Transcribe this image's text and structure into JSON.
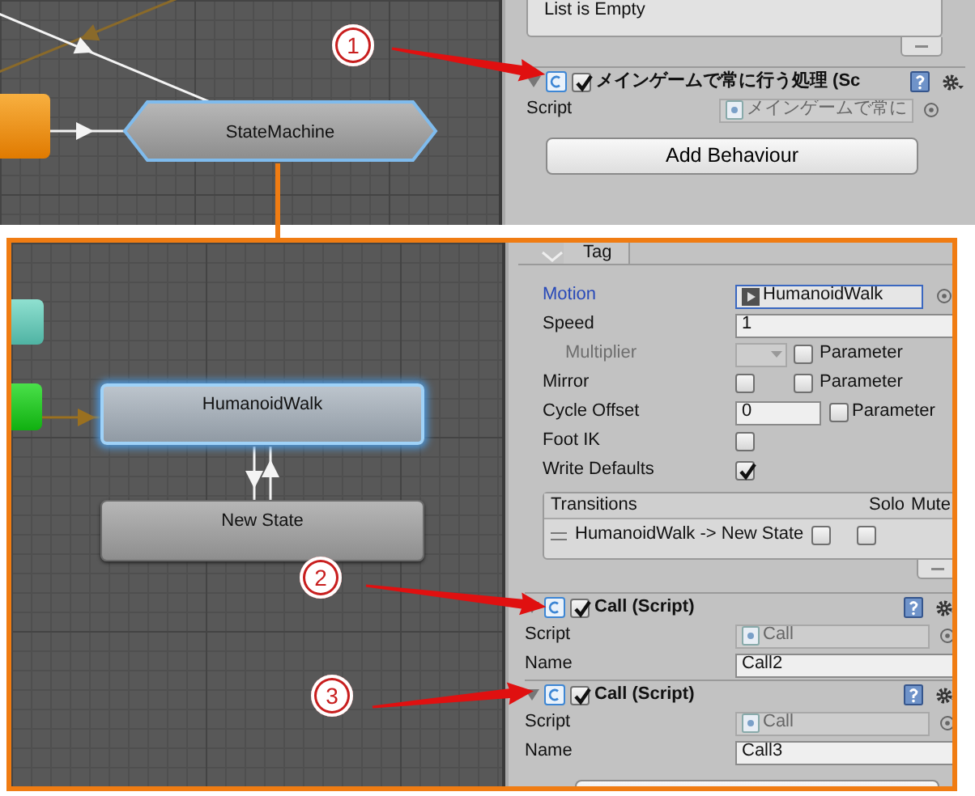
{
  "top": {
    "graph": {
      "nodes": [
        {
          "kind": "state-machine",
          "label": "StateMachine",
          "selected": true
        }
      ]
    },
    "inspector": {
      "list_text": "List is Empty",
      "component": {
        "expanded": true,
        "enabled": true,
        "title": "メインゲームで常に行う処理 (Sc",
        "fields": [
          {
            "kind": "script",
            "label": "Script",
            "value": "メインゲームで常に"
          }
        ]
      },
      "add_button": "Add Behaviour"
    }
  },
  "bottom": {
    "graph": {
      "nodes": [
        {
          "kind": "state",
          "label": "HumanoidWalk",
          "selected": true
        },
        {
          "kind": "state",
          "label": "New State",
          "selected": false
        }
      ]
    },
    "inspector": {
      "tag": "Tag",
      "fields": [
        {
          "kind": "object",
          "label": "Motion",
          "highlighted": true,
          "disabled": false,
          "value": "HumanoidWalk"
        },
        {
          "kind": "text",
          "label": "Speed",
          "highlighted": false,
          "disabled": false,
          "value": "1"
        },
        {
          "kind": "dropdown-param",
          "label": "Multiplier",
          "highlighted": false,
          "disabled": true,
          "param_label": "Parameter",
          "param_checked": false
        },
        {
          "kind": "checkbox-param",
          "label": "Mirror",
          "highlighted": false,
          "disabled": false,
          "checked": false,
          "param_label": "Parameter",
          "param_checked": false
        },
        {
          "kind": "text-param",
          "label": "Cycle Offset",
          "highlighted": false,
          "disabled": false,
          "value": "0",
          "param_label": "Parameter",
          "param_checked": false
        },
        {
          "kind": "checkbox",
          "label": "Foot IK",
          "highlighted": false,
          "disabled": false,
          "checked": false
        },
        {
          "kind": "checkbox",
          "label": "Write Defaults",
          "highlighted": false,
          "disabled": false,
          "checked": true
        }
      ],
      "transitions": {
        "title": "Transitions",
        "solo_label": "Solo",
        "mute_label": "Mute",
        "rows": [
          {
            "name": "HumanoidWalk -> New State",
            "solo": false,
            "mute": false
          }
        ]
      },
      "components": [
        {
          "expanded": true,
          "enabled": true,
          "title": "Call (Script)",
          "fields": [
            {
              "kind": "script",
              "label": "Script",
              "value": "Call"
            },
            {
              "kind": "text",
              "label": "Name",
              "value": "Call2"
            }
          ]
        },
        {
          "expanded": true,
          "enabled": true,
          "title": "Call (Script)",
          "fields": [
            {
              "kind": "script",
              "label": "Script",
              "value": "Call"
            },
            {
              "kind": "text",
              "label": "Name",
              "value": "Call3"
            }
          ]
        }
      ]
    }
  },
  "annotations": [
    {
      "label": "1"
    },
    {
      "label": "2"
    },
    {
      "label": "3"
    }
  ]
}
